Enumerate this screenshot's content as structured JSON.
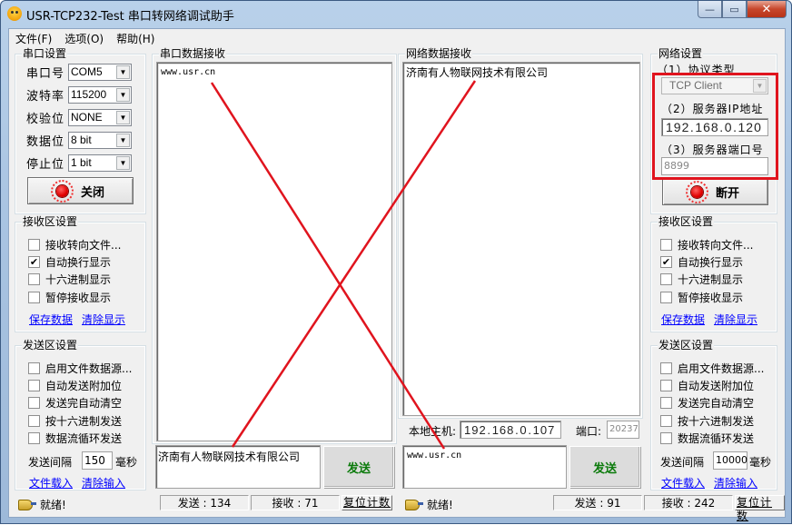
{
  "window": {
    "title": "USR-TCP232-Test 串口转网络调试助手",
    "caption_buttons": {
      "minimize": "—",
      "maximize": "▭",
      "close": "✕"
    }
  },
  "menu": [
    "文件(F)",
    "选项(O)",
    "帮助(H)"
  ],
  "serial_settings": {
    "title": "串口设置",
    "fields": [
      {
        "label": "串口号",
        "value": "COM5"
      },
      {
        "label": "波特率",
        "value": "115200"
      },
      {
        "label": "校验位",
        "value": "NONE"
      },
      {
        "label": "数据位",
        "value": "8 bit"
      },
      {
        "label": "停止位",
        "value": "1 bit"
      }
    ],
    "toggle_button": "关闭"
  },
  "left_receive_settings": {
    "title": "接收区设置",
    "options": [
      {
        "label": "接收转向文件...",
        "checked": false
      },
      {
        "label": "自动换行显示",
        "checked": true
      },
      {
        "label": "十六进制显示",
        "checked": false
      },
      {
        "label": "暂停接收显示",
        "checked": false
      }
    ],
    "links": [
      "保存数据",
      "清除显示"
    ]
  },
  "left_send_settings": {
    "title": "发送区设置",
    "options": [
      {
        "label": "启用文件数据源...",
        "checked": false
      },
      {
        "label": "自动发送附加位",
        "checked": false
      },
      {
        "label": "发送完自动清空",
        "checked": false
      },
      {
        "label": "按十六进制发送",
        "checked": false
      },
      {
        "label": "数据流循环发送",
        "checked": false
      }
    ],
    "interval_label": "发送间隔",
    "interval_value": "150",
    "interval_unit": "毫秒",
    "links": [
      "文件载入",
      "清除输入"
    ]
  },
  "serial_receive": {
    "title": "串口数据接收",
    "content": "www.usr.cn"
  },
  "serial_send": {
    "content": "济南有人物联网技术有限公司",
    "send_button": "发送"
  },
  "left_status": {
    "ready_text": "就绪!",
    "sent": "发送 : 134",
    "received": "接收 : 71",
    "reset_button": "复位计数"
  },
  "network_receive": {
    "title": "网络数据接收",
    "content": "济南有人物联网技术有限公司"
  },
  "local_host": {
    "label": "本地主机:",
    "ip": [
      "192",
      "168",
      "0",
      "107"
    ],
    "port_label": "端口:",
    "port": "20237"
  },
  "network_send": {
    "content": "www.usr.cn",
    "send_button": "发送"
  },
  "right_status": {
    "ready_text": "就绪!",
    "sent": "发送 : 91",
    "received": "接收 : 242",
    "reset_button": "复位计数"
  },
  "network_settings": {
    "title": "网络设置",
    "protocol_label": "（1）协议类型",
    "protocol_value": "TCP Client",
    "server_ip_label": "（2）服务器IP地址",
    "server_ip": [
      "192",
      "168",
      "0",
      "120"
    ],
    "server_port_label": "（3）服务器端口号",
    "server_port": "8899",
    "toggle_button": "断开"
  },
  "right_receive_settings": {
    "title": "接收区设置",
    "options": [
      {
        "label": "接收转向文件...",
        "checked": false
      },
      {
        "label": "自动换行显示",
        "checked": true
      },
      {
        "label": "十六进制显示",
        "checked": false
      },
      {
        "label": "暂停接收显示",
        "checked": false
      }
    ],
    "links": [
      "保存数据",
      "清除显示"
    ]
  },
  "right_send_settings": {
    "title": "发送区设置",
    "options": [
      {
        "label": "启用文件数据源...",
        "checked": false
      },
      {
        "label": "自动发送附加位",
        "checked": false
      },
      {
        "label": "发送完自动清空",
        "checked": false
      },
      {
        "label": "按十六进制发送",
        "checked": false
      },
      {
        "label": "数据流循环发送",
        "checked": false
      }
    ],
    "interval_label": "发送间隔",
    "interval_value": "10000",
    "interval_unit": "毫秒",
    "links": [
      "文件载入",
      "清除输入"
    ]
  },
  "annotation": {
    "color": "#e0141e",
    "type": "red-x-cross-and-highlight-box"
  }
}
